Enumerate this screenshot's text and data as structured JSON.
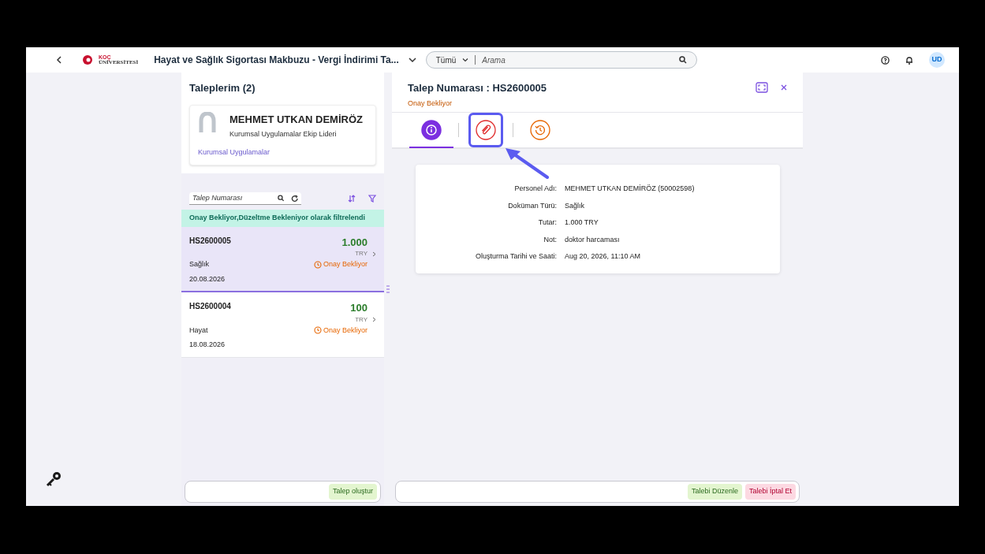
{
  "header": {
    "logo": {
      "line1": "KOÇ",
      "line2": "ÜNİVERSİTESİ"
    },
    "title": "Hayat ve Sağlık Sigortası Makbuzu - Vergi İndirimi Ta...",
    "search": {
      "scope": "Tümü",
      "placeholder": "Arama"
    },
    "avatar": "UD"
  },
  "left": {
    "title": "Taleplerim (2)",
    "profile": {
      "name": "MEHMET UTKAN DEMİRÖZ",
      "role": "Kurumsal Uygulamalar Ekip Lideri",
      "department": "Kurumsal Uygulamalar"
    },
    "search": {
      "placeholder": "Talep Numarası"
    },
    "filter_banner": "Onay Bekliyor,Düzeltme Bekleniyor olarak filtrelendi",
    "requests": [
      {
        "number": "HS2600005",
        "amount": "1.000",
        "currency": "TRY",
        "type": "Sağlık",
        "status": "Onay Bekliyor",
        "date": "20.08.2026",
        "selected": true
      },
      {
        "number": "HS2600004",
        "amount": "100",
        "currency": "TRY",
        "type": "Hayat",
        "status": "Onay Bekliyor",
        "date": "18.08.2026",
        "selected": false
      }
    ],
    "create_button": "Talep oluştur"
  },
  "right": {
    "title": "Talep Numarası : HS2600005",
    "status": "Onay Bekliyor",
    "tabs": [
      {
        "kind": "info",
        "selected": true,
        "highlighted": false
      },
      {
        "kind": "attachment",
        "selected": false,
        "highlighted": true
      },
      {
        "kind": "history",
        "selected": false,
        "highlighted": false
      }
    ],
    "details": [
      {
        "label": "Personel Adı:",
        "value": "MEHMET UTKAN DEMİRÖZ (50002598)"
      },
      {
        "label": "Doküman Türü:",
        "value": "Sağlık"
      },
      {
        "label": "Tutar:",
        "value": "1.000 TRY"
      },
      {
        "label": "Not:",
        "value": "doktor harcaması"
      },
      {
        "label": "Oluşturma Tarihi ve Saati:",
        "value": "Aug 20, 2026, 11:10 AM"
      }
    ],
    "buttons": [
      {
        "label": "Talebi Düzenle",
        "kind": "edit"
      },
      {
        "label": "Talebi İptal Et",
        "kind": "cancel"
      }
    ]
  }
}
